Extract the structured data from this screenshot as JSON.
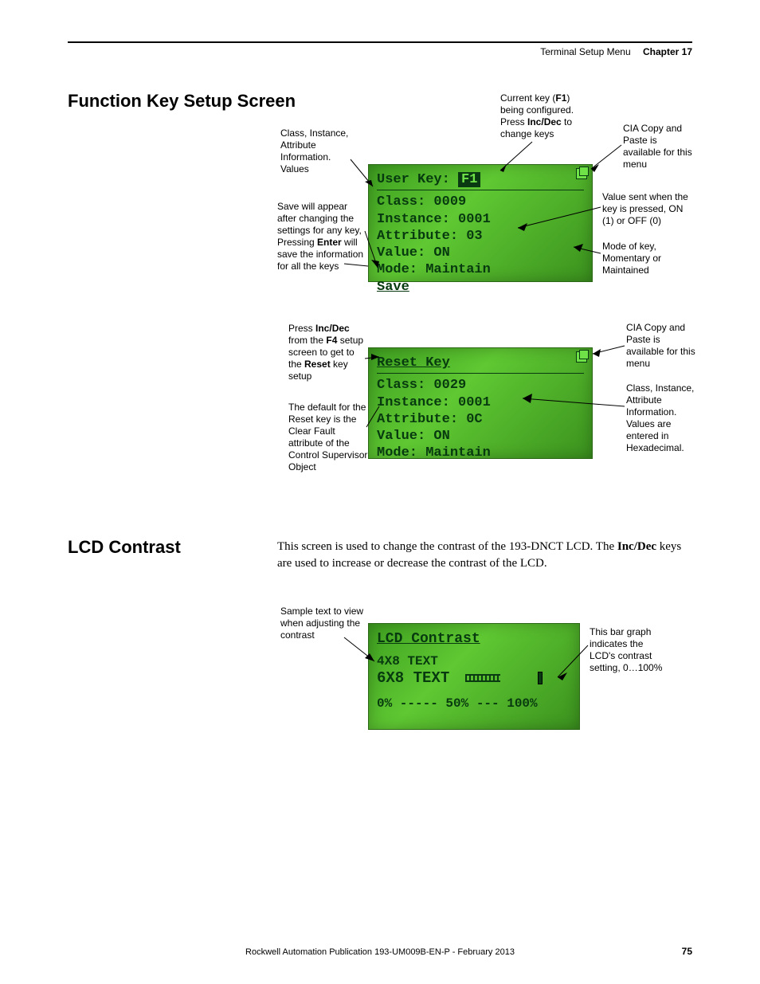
{
  "header": {
    "left": "Terminal Setup Menu",
    "right": "Chapter 17"
  },
  "section1": {
    "title": "Function Key Setup Screen"
  },
  "lcd1": {
    "line1a": "User Key:",
    "line1b": "F1",
    "class": "Class:  0009",
    "instance": "Instance:  0001",
    "attribute": "Attribute:  03",
    "value": "Value:   ON",
    "mode": "Mode:    Maintain",
    "save": "Save"
  },
  "call1": {
    "current": "Current key (F1) being configured. Press Inc/Dec to change keys",
    "cia": "CIA Copy and Paste is available for this menu",
    "valuesent": "Value sent when the key is pressed, ON (1) or OFF (0)",
    "modeof": "Mode of key, Momentary or Maintained",
    "classinst": "Class, Instance, Attribute Information. Values",
    "savewill": "Save will appear after changing the settings for any key, Pressing Enter will save the information for all the keys"
  },
  "lcd2": {
    "title": "Reset Key",
    "class": "Class:  0029",
    "instance": "Instance:  0001",
    "attribute": "Attribute:  0C",
    "value": "Value:   ON",
    "mode": "Mode:    Maintain"
  },
  "call2": {
    "press": "Press Inc/Dec from the F4 setup screen to get to the Reset key setup",
    "default": "The default for the Reset key is the Clear Fault attribute of the Control Supervisor Object",
    "cia": "CIA Copy and Paste is available for this menu",
    "classhex": "Class, Instance, Attribute Information. Values are entered in Hexadecimal."
  },
  "section2": {
    "title": "LCD Contrast",
    "body": "This screen is used to change the contrast of the 193-DNCT LCD. The Inc/Dec keys are used to increase or decrease the contrast of the LCD."
  },
  "lcd3": {
    "title": "LCD Contrast",
    "l1": "4X8 TEXT",
    "l2": "6X8 TEXT",
    "scale": "0%  -----  50%  ---  100%"
  },
  "call3": {
    "sample": "Sample text to view when adjusting the contrast",
    "bar": "This bar graph indicates the LCD's contrast setting, 0…100%"
  },
  "footer": "Rockwell Automation Publication 193-UM009B-EN-P - February 2013",
  "page": "75"
}
